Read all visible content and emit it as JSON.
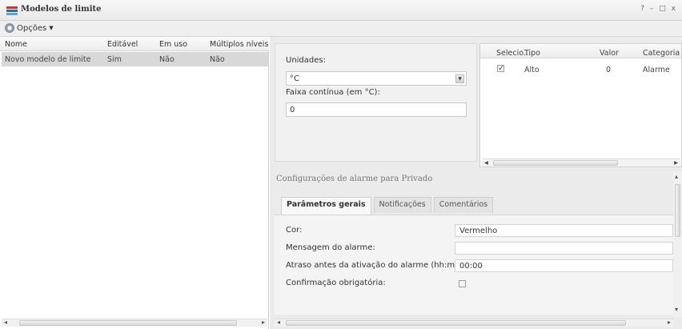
{
  "window": {
    "title": "Modelos de limite",
    "controls": [
      "?",
      "–",
      "□",
      "x"
    ]
  },
  "toolbar": {
    "options_label": "Opções"
  },
  "templates_grid": {
    "columns": [
      "Nome",
      "Editável",
      "Em uso",
      "Múltiplos níveis"
    ],
    "rows": [
      [
        "Novo modelo de limite",
        "Sim",
        "Não",
        "Não"
      ]
    ]
  },
  "units_panel": {
    "units_label": "Unidades:",
    "units_value": "°C",
    "deadband_label": "Faixa contínua (em °C):",
    "deadband_value": "0"
  },
  "limits_grid": {
    "columns": [
      "Selecio...",
      "Tipo",
      "Valor",
      "Categoria"
    ],
    "rows": [
      {
        "selected": "✓",
        "tipo": "Alto",
        "valor": "0",
        "categoria": "Alarme"
      }
    ]
  },
  "alarm_section": {
    "title": "Configurações de alarme para Privado",
    "tabs": [
      "Parâmetros gerais",
      "Notificações",
      "Comentários"
    ],
    "fields": {
      "color_label": "Cor:",
      "color_value": "Vermelho",
      "message_label": "Mensagem do alarme:",
      "message_value": "",
      "delay_label": "Atraso antes da ativação do alarme (hh:mm):",
      "delay_value": "00:00",
      "ack_label": "Confirmação obrigatória:"
    }
  },
  "colors": {
    "accent": "#4a6a8a",
    "selected_row": "#d8d8d8"
  }
}
